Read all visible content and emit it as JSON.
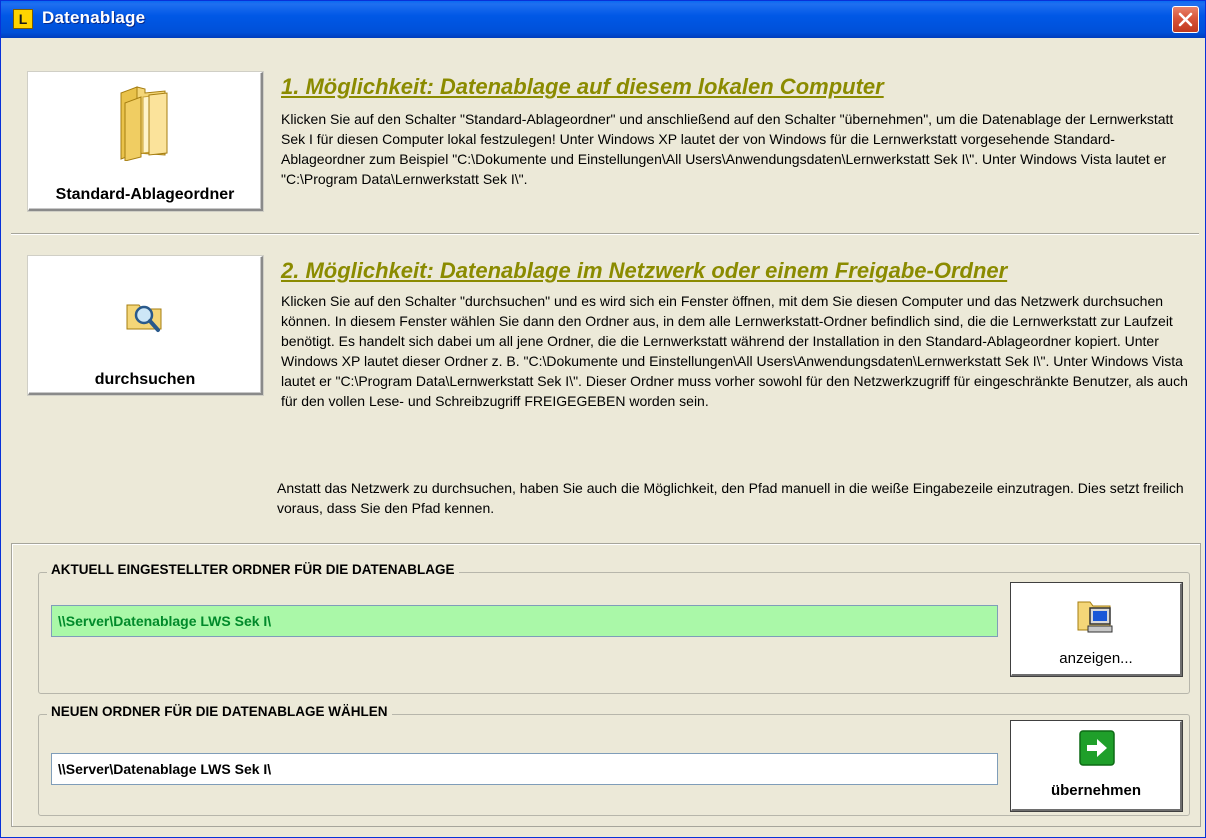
{
  "window": {
    "title": "Datenablage",
    "app_icon_letter": "L"
  },
  "option1": {
    "button_label": "Standard-Ablageordner",
    "heading": "1. Möglichkeit: Datenablage auf diesem lokalen Computer",
    "text": "Klicken Sie auf den Schalter \"Standard-Ablageordner\" und anschließend auf den Schalter \"übernehmen\", um die Datenablage der Lernwerkstatt Sek I für diesen Computer lokal festzulegen! Unter Windows XP lautet der von Windows für die Lernwerkstatt vorgesehende Standard-Ablageordner zum Beispiel \"C:\\Dokumente und Einstellungen\\All Users\\Anwendungsdaten\\Lernwerkstatt Sek I\\\". Unter Windows Vista lautet er \"C:\\Program Data\\Lernwerkstatt Sek I\\\"."
  },
  "option2": {
    "button_label": "durchsuchen",
    "heading": "2. Möglichkeit: Datenablage im Netzwerk oder einem Freigabe-Ordner",
    "text1": "Klicken Sie auf den Schalter \"durchsuchen\" und es wird sich ein Fenster öffnen, mit dem Sie diesen Computer und das Netzwerk durchsuchen können. In diesem Fenster wählen Sie dann den Ordner aus, in dem alle Lernwerkstatt-Ordner befindlich sind, die die Lernwerkstatt zur Laufzeit benötigt. Es handelt sich dabei um all jene Ordner, die die Lernwerkstatt während der Installation in den Standard-Ablageordner kopiert. Unter Windows XP lautet dieser Ordner z. B. \"C:\\Dokumente und Einstellungen\\All Users\\Anwendungsdaten\\Lernwerkstatt Sek I\\\". Unter Windows Vista lautet er \"C:\\Program Data\\Lernwerkstatt Sek I\\\". Dieser Ordner muss vorher sowohl für den Netzwerkzugriff für eingeschränkte Benutzer, als auch für den vollen Lese- und Schreibzugriff FREIGEGEBEN worden sein.",
    "text2": "Anstatt das Netzwerk zu durchsuchen, haben Sie auch die Möglichkeit, den Pfad manuell in die weiße Eingabezeile einzutragen. Dies setzt freilich voraus, dass Sie den Pfad kennen."
  },
  "current_folder": {
    "group_title": "AKTUELL EINGESTELLTER ORDNER FÜR DIE DATENABLAGE",
    "value": "\\\\Server\\Datenablage LWS Sek I\\",
    "button_label": "anzeigen..."
  },
  "new_folder": {
    "group_title": "NEUEN ORDNER FÜR DIE DATENABLAGE WÄHLEN",
    "value": "\\\\Server\\Datenablage LWS Sek I\\",
    "button_label": "übernehmen"
  },
  "colors": {
    "heading": "#8b8b00",
    "current_field_bg": "#aaf8a8",
    "current_field_text": "#008a2a",
    "titlebar": "#0058e6",
    "window_bg": "#ece9d8"
  },
  "icons": {
    "folder_icon": "folder-icon",
    "search_folder_icon": "folder-search-icon",
    "computer_folder_icon": "folder-computer-icon",
    "green_arrow_icon": "green-arrow-right-icon",
    "close_icon": "close-icon"
  }
}
